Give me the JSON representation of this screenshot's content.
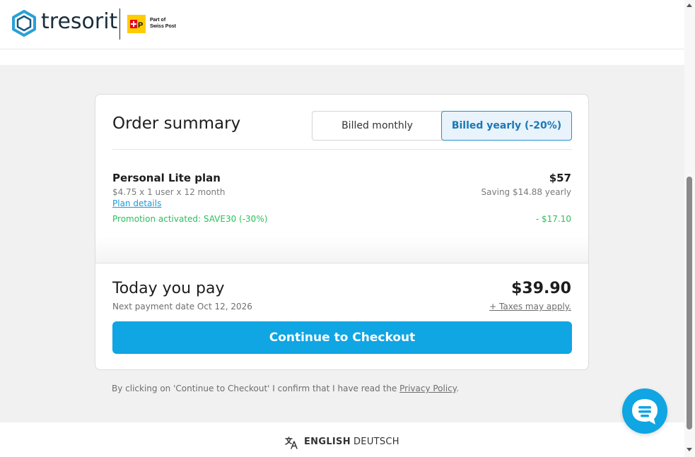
{
  "brand": {
    "logo_text": "tresorit",
    "partner_line1": "Part of",
    "partner_line2": "Swiss Post",
    "accent": "#10a5e3"
  },
  "order": {
    "title": "Order summary",
    "billing_options": [
      {
        "label": "Billed monthly",
        "selected": false
      },
      {
        "label": "Billed yearly (-20%)",
        "selected": true
      }
    ],
    "plan_name": "Personal Lite plan",
    "plan_detail": "$4.75 x 1 user x 12 month",
    "plan_link": "Plan details",
    "promotion": "Promotion activated: SAVE30 (-30%)",
    "price": "$57",
    "saving": "Saving $14.88 yearly",
    "discount": "- $17.10"
  },
  "payment": {
    "title": "Today you pay",
    "next_payment": "Next payment date Oct 12, 2026",
    "total": "$39.90",
    "taxes": "+ Taxes may apply.",
    "checkout_label": "Continue to Checkout"
  },
  "consent": {
    "text": "By clicking on 'Continue to Checkout' I confirm that I have read the ",
    "link": "Privacy Policy",
    "end": "."
  },
  "languages": {
    "english": "ENGLISH",
    "deutsch": "DEUTSCH"
  },
  "icons": {
    "logo": "tresorit-hexagon-icon",
    "post": "swiss-post-icon",
    "translate": "translate-icon",
    "chat": "chat-icon"
  }
}
